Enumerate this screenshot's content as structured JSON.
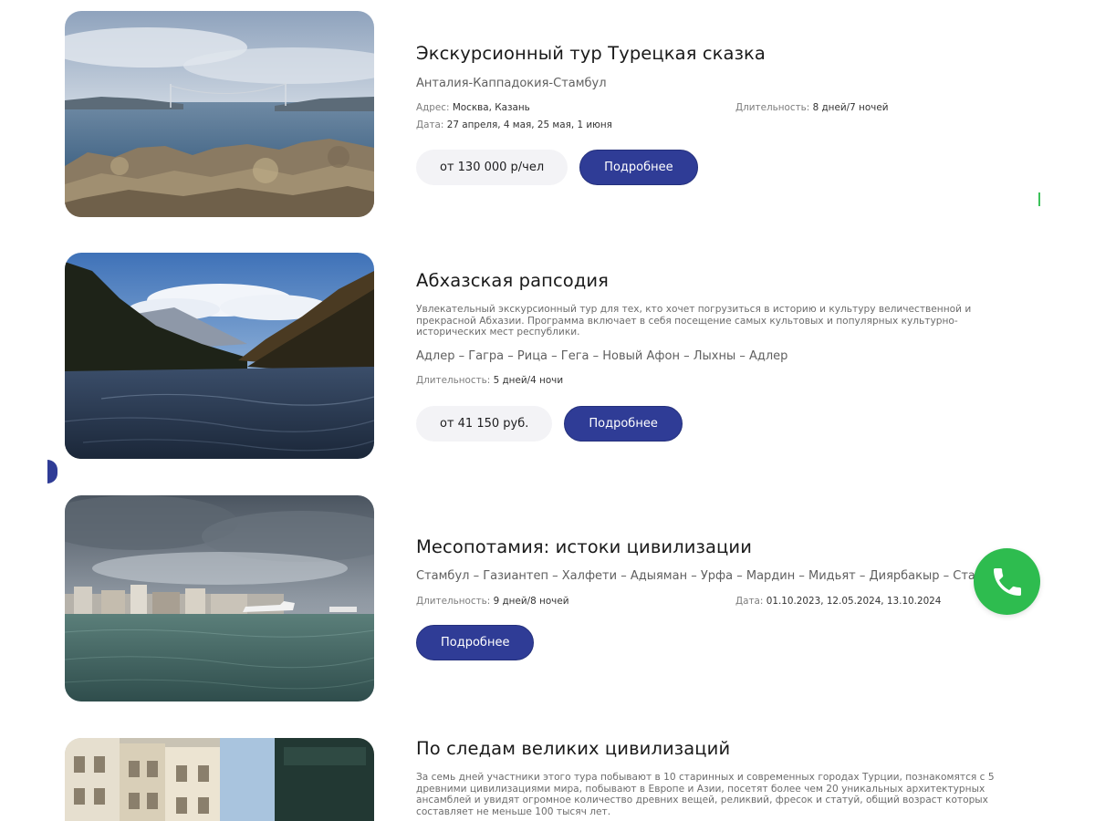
{
  "tours": [
    {
      "title": "Экскурсионный тур Турецкая сказка",
      "route": "Анталия-Каппадокия-Стамбул",
      "address_label": "Адрес:",
      "address_value": "Москва, Казань",
      "duration_label": "Длительность:",
      "duration_value": "8 дней/7 ночей",
      "date_label": "Дата:",
      "date_value": "27 апреля, 4 мая, 25 мая, 1 июня",
      "price": "от 130 000 р/чел",
      "button": "Подробнее"
    },
    {
      "title": "Абхазская рапсодия",
      "description": "Увлекательный экскурсионный тур для тех, кто хочет погрузиться в историю и культуру величественной и прекрасной Абхазии. Программа включает в себя посещение самых культовых и популярных культурно-исторических мест республики.",
      "route": "Адлер – Гагра – Рица – Гега – Новый Афон – Лыхны – Адлер",
      "duration_label": "Длительность:",
      "duration_value": "5 дней/4 ночи",
      "price": "от 41 150 руб.",
      "button": "Подробнее"
    },
    {
      "title": "Месопотамия: истоки цивилизации",
      "route": "Стамбул – Газиантеп – Халфети – Адыяман – Урфа – Мардин – Мидьят – Диярбакыр – Стамбул",
      "duration_label": "Длительность:",
      "duration_value": "9 дней/8 ночей",
      "date_label": "Дата:",
      "date_value": "01.10.2023, 12.05.2024, 13.10.2024",
      "button": "Подробнее"
    },
    {
      "title": "По следам великих цивилизаций",
      "description": "За семь дней участники этого тура побывают в 10 старинных и современных городах Турции, познакомятся с 5 древними цивилизациями мира, побывают в Европе и Азии, посетят более чем 20 уникальных архитектурных ансамблей и увидят огромное  количество древних вещей, реликвий, фресок и статуй, общий возраст которых составляет не меньше 100 тысяч лет."
    }
  ],
  "floating": {
    "call_icon": "phone-icon",
    "call_color": "#2ebc4f",
    "accent_color": "#2f3c96"
  }
}
